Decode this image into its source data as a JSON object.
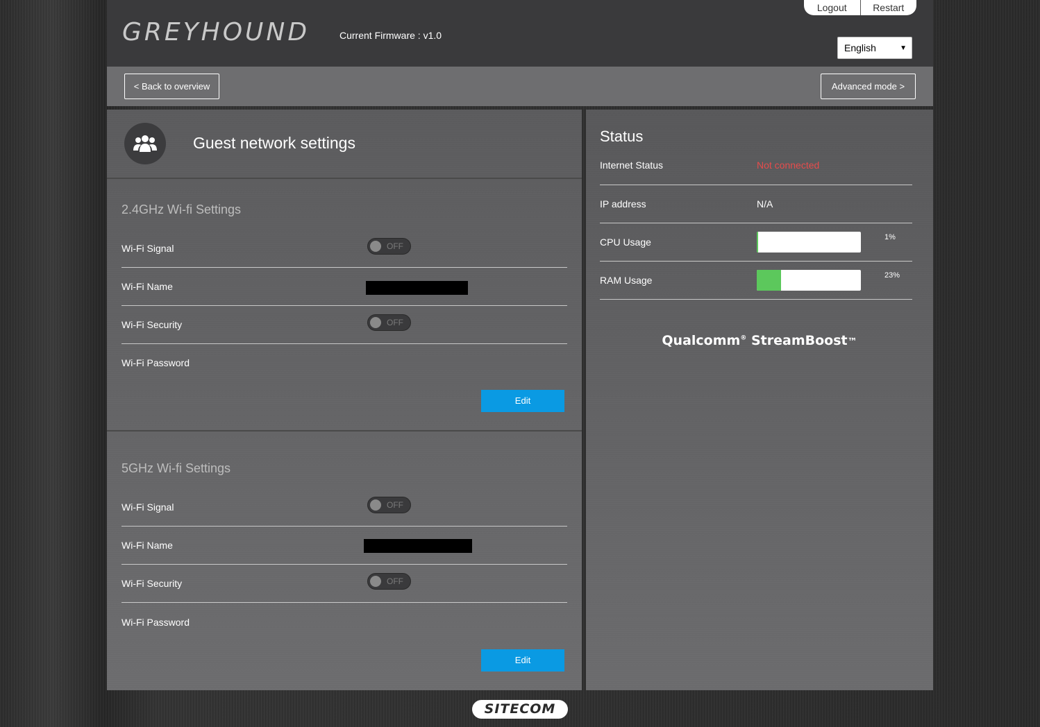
{
  "header": {
    "logo": "GREYHOUND",
    "firmware": "Current Firmware : v1.0",
    "logout": "Logout",
    "restart": "Restart",
    "language": "English"
  },
  "nav": {
    "back": "< Back to overview",
    "advanced": "Advanced mode >"
  },
  "guest": {
    "title": "Guest network settings",
    "icon": "users-group-icon"
  },
  "wifi24": {
    "title": "2.4GHz Wi-fi Settings",
    "signal_label": "Wi-Fi Signal",
    "signal_state": "OFF",
    "name_label": "Wi-Fi Name",
    "security_label": "Wi-Fi Security",
    "security_state": "OFF",
    "password_label": "Wi-Fi Password",
    "edit": "Edit"
  },
  "wifi5": {
    "title": "5GHz Wi-fi Settings",
    "signal_label": "Wi-Fi Signal",
    "signal_state": "OFF",
    "name_label": "Wi-Fi Name",
    "security_label": "Wi-Fi Security",
    "security_state": "OFF",
    "password_label": "Wi-Fi Password",
    "edit": "Edit"
  },
  "status": {
    "title": "Status",
    "internet_label": "Internet Status",
    "internet_value": "Not connected",
    "ip_label": "IP address",
    "ip_value": "N/A",
    "cpu_label": "CPU Usage",
    "cpu_pct": "1%",
    "cpu_value": 1,
    "ram_label": "RAM Usage",
    "ram_pct": "23%",
    "ram_value": 23,
    "bar_color": "#5cc85c",
    "error_color": "#e64c4c"
  },
  "branding": {
    "qualcomm": "Qualcomm",
    "streamboost": "StreamBoost",
    "footer": "SITECOM"
  },
  "colors": {
    "edit_button": "#0a9ae3"
  }
}
